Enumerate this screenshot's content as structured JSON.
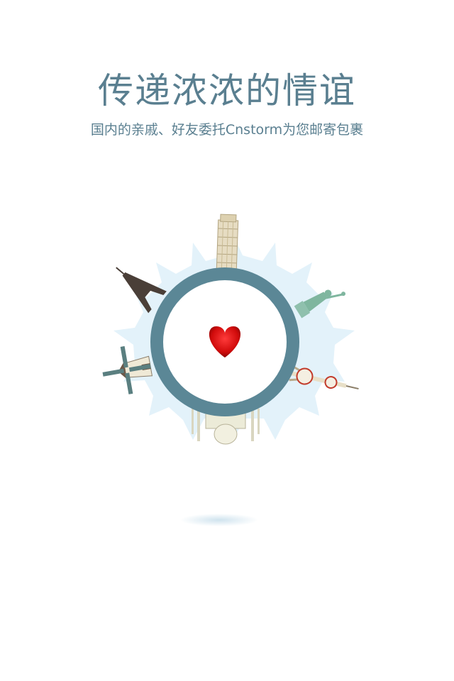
{
  "screen": {
    "title": "传递浓浓的情谊",
    "subtitle": "国内的亲戚、好友委托Cnstorm为您邮寄包裹"
  },
  "illustration": {
    "landmarks": [
      "leaning-tower-of-pisa",
      "eiffel-tower",
      "statue-of-liberty",
      "windmill",
      "oriental-pearl-tower",
      "taj-mahal"
    ],
    "center_icon": "heart-icon",
    "colors": {
      "ring": "#5b8796",
      "burst": "#dceef8",
      "heart": "#d10b0b",
      "text": "#5a7f90"
    }
  }
}
